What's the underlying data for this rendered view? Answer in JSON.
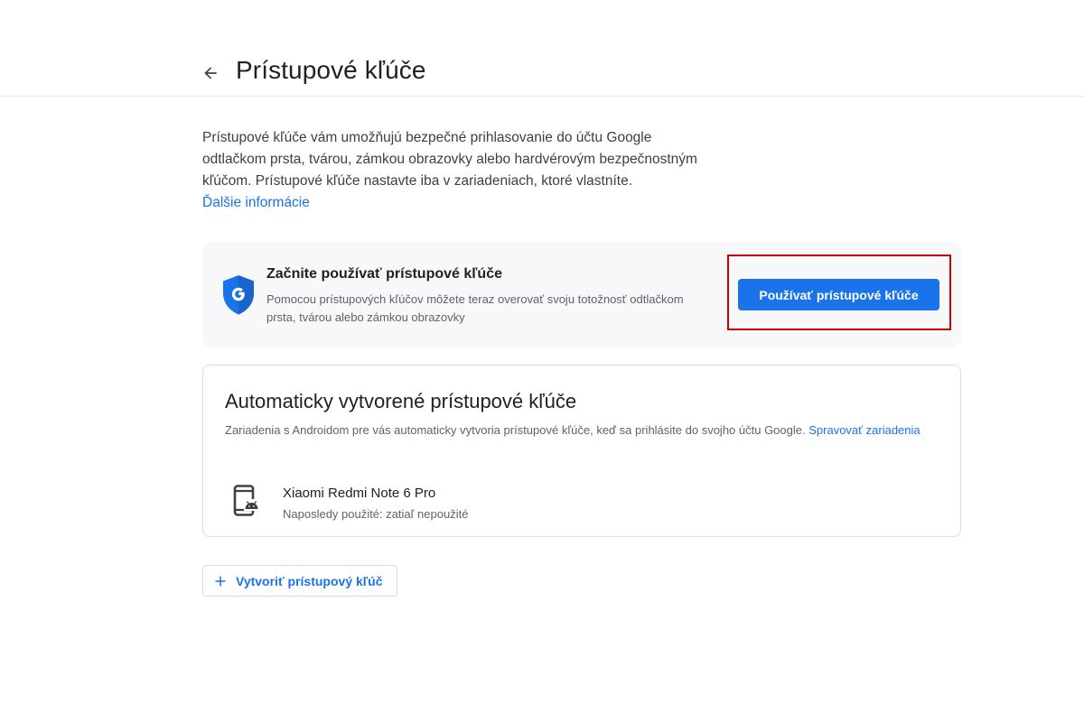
{
  "header": {
    "back_icon": "arrow-back-icon",
    "title": "Prístupové kľúče"
  },
  "intro": {
    "text": "Prístupové kľúče vám umožňujú bezpečné prihlasovanie do účtu Google odtlačkom prsta, tvárou, zámkou obrazovky alebo hardvérovým bezpečnostným kľúčom. Prístupové kľúče nastavte iba v zariadeniach, ktoré vlastníte.",
    "link": "Ďalšie informácie"
  },
  "promo": {
    "icon": "google-shield-icon",
    "title": "Začnite používať prístupové kľúče",
    "description": "Pomocou prístupových kľúčov môžete teraz overovať svoju totožnosť odtlačkom prsta, tvárou alebo zámkou obrazovky",
    "button_label": "Používať prístupové kľúče",
    "highlight_color": "#d10000"
  },
  "auto": {
    "title": "Automaticky vytvorené prístupové kľúče",
    "description": "Zariadenia s Androidom pre vás automaticky vytvoria prístupové kľúče, keď sa prihlásite do svojho účtu Google.",
    "link": "Spravovať zariadenia",
    "devices": [
      {
        "icon": "android-device-icon",
        "name": "Xiaomi Redmi Note 6 Pro",
        "meta": "Naposledy použité: zatiaľ nepoužité"
      }
    ]
  },
  "create": {
    "icon": "plus-icon",
    "label": "Vytvoriť prístupový kľúč"
  },
  "colors": {
    "accent": "#1a73e8",
    "text_primary": "#202124",
    "text_secondary": "#5f6368",
    "card_bg": "#f7f8fa",
    "border": "#dadce0"
  }
}
